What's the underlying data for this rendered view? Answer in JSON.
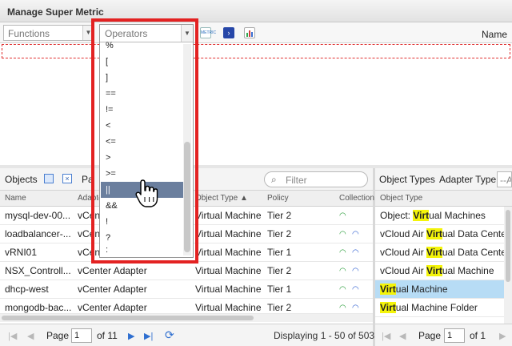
{
  "window": {
    "title": "Manage Super Metric"
  },
  "toolbar": {
    "functions_value": "Functions",
    "operators_value": "Operators",
    "name_label": "Name",
    "icons": [
      "metrics-icon",
      "go-icon",
      "chart-icon"
    ],
    "metrics_icon_text": "METRIC"
  },
  "operators_dropdown": {
    "items": [
      "%",
      "[",
      "]",
      "==",
      "!=",
      "<",
      "<=",
      ">",
      ">=",
      "||",
      "&&",
      "!",
      "?",
      ":"
    ],
    "selected": "||"
  },
  "objects_panel": {
    "label": "Objects",
    "page_label": "Pa",
    "filter_placeholder": "Filter",
    "columns": [
      "Name",
      "Adapter Type",
      "Object Type ▲",
      "Policy",
      "Collection"
    ],
    "rows": [
      {
        "name": "mysql-dev-00...",
        "adapter": "vCenter Adapter",
        "object_type": "Virtual Machine",
        "policy": "Tier 2"
      },
      {
        "name": "loadbalancer-...",
        "adapter": "vCenter Adapter",
        "object_type": "Virtual Machine",
        "policy": "Tier 2"
      },
      {
        "name": "vRNI01",
        "adapter": "vCenter Adapter",
        "object_type": "Virtual Machine",
        "policy": "Tier 1"
      },
      {
        "name": "NSX_Controll...",
        "adapter": "vCenter Adapter",
        "object_type": "Virtual Machine",
        "policy": "Tier 2"
      },
      {
        "name": "dhcp-west",
        "adapter": "vCenter Adapter",
        "object_type": "Virtual Machine",
        "policy": "Tier 1"
      },
      {
        "name": "mongodb-bac...",
        "adapter": "vCenter Adapter",
        "object_type": "Virtual Machine",
        "policy": "Tier 2"
      }
    ],
    "pager": {
      "page_label": "Page",
      "page_value": "1",
      "of_label": "of 11",
      "displaying": "Displaying 1 - 50 of 503"
    }
  },
  "object_types_panel": {
    "label": "Object Types",
    "adapter_type_label": "Adapter Type:",
    "adapter_type_placeholder": "--Al",
    "column": "Object Type",
    "rows": [
      {
        "prefix": "Object: ",
        "match": "Virt",
        "suffix": "ual Machines"
      },
      {
        "prefix": "vCloud Air ",
        "match": "Virt",
        "suffix": "ual Data Center"
      },
      {
        "prefix": "vCloud Air ",
        "match": "Virt",
        "suffix": "ual Data Center:Virt"
      },
      {
        "prefix": "vCloud Air ",
        "match": "Virt",
        "suffix": "ual Machine"
      },
      {
        "prefix": "",
        "match": "Virt",
        "suffix": "ual Machine"
      },
      {
        "prefix": "",
        "match": "Virt",
        "suffix": "ual Machine Folder"
      }
    ],
    "selected_index": 4,
    "pager": {
      "page_label": "Page",
      "page_value": "1",
      "of_label": "of 1"
    }
  }
}
